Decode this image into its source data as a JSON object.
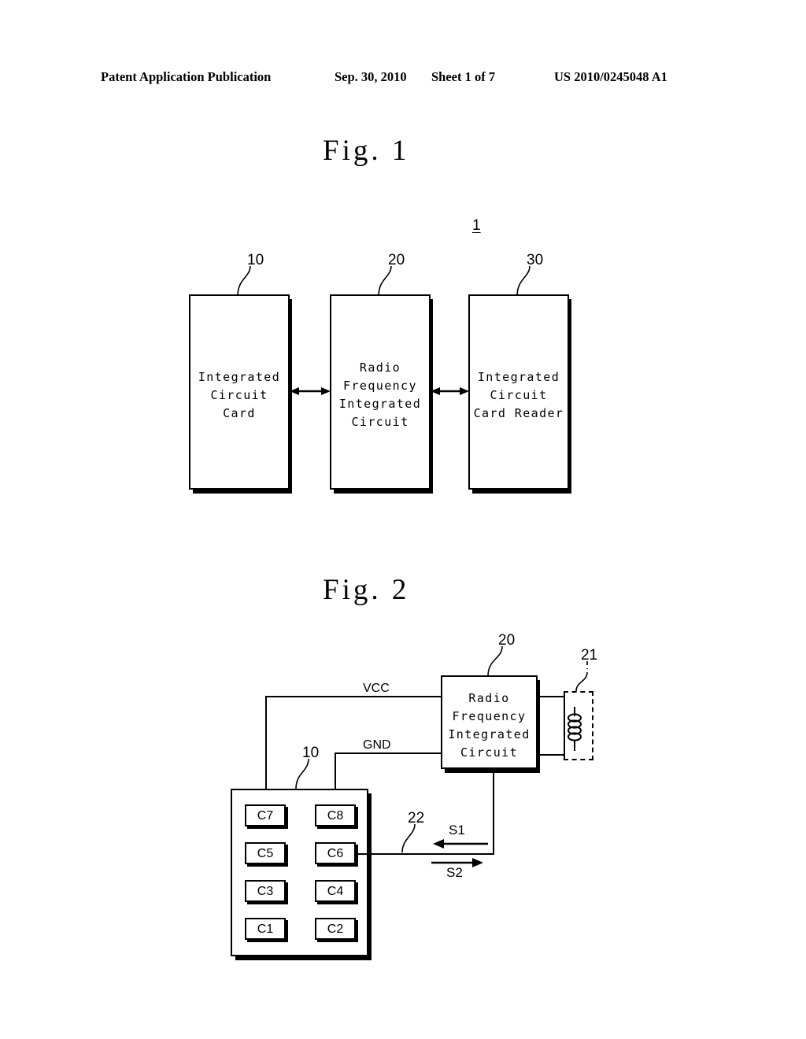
{
  "header": {
    "publication": "Patent Application Publication",
    "date": "Sep. 30, 2010",
    "sheet": "Sheet 1 of 7",
    "patent_number": "US 2010/0245048 A1"
  },
  "figure1": {
    "caption": "Fig.  1",
    "system_ref": "1",
    "blocks": [
      {
        "ref": "10",
        "text": "Integrated\nCircuit\nCard"
      },
      {
        "ref": "20",
        "text": "Radio\nFrequency\nIntegrated\nCircuit"
      },
      {
        "ref": "30",
        "text": "Integrated\nCircuit\nCard Reader"
      }
    ]
  },
  "figure2": {
    "caption": "Fig.  2",
    "rfic": {
      "ref": "20",
      "text": "Radio\nFrequency\nIntegrated\nCircuit"
    },
    "antenna": {
      "ref": "21",
      "icon": "inductor-coil-icon"
    },
    "card": {
      "ref": "10"
    },
    "contacts": [
      {
        "id": "C7"
      },
      {
        "id": "C8"
      },
      {
        "id": "C5"
      },
      {
        "id": "C6"
      },
      {
        "id": "C3"
      },
      {
        "id": "C4"
      },
      {
        "id": "C1"
      },
      {
        "id": "C2"
      }
    ],
    "wires": {
      "vcc_label": "VCC",
      "gnd_label": "GND",
      "signal_line_ref": "22",
      "signal_in_label": "S1",
      "signal_out_label": "S2"
    }
  },
  "colors": {
    "ink": "#000000",
    "paper": "#ffffff"
  }
}
